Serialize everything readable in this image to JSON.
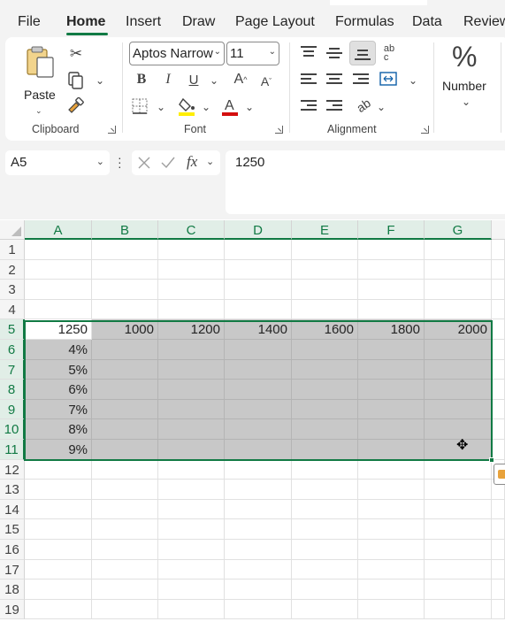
{
  "menu": {
    "tabs": [
      "File",
      "Home",
      "Insert",
      "Draw",
      "Page Layout",
      "Formulas",
      "Data",
      "Review"
    ],
    "active_tab": "Home"
  },
  "ribbon": {
    "clipboard": {
      "paste_label": "Paste",
      "group_label": "Clipboard"
    },
    "font": {
      "font_name": "Aptos Narrow",
      "font_size": "11",
      "group_label": "Font"
    },
    "alignment": {
      "group_label": "Alignment"
    },
    "number": {
      "symbol": "%",
      "label": "Number"
    }
  },
  "formula_bar": {
    "name_box": "A5",
    "fx_label": "fx",
    "formula": "1250"
  },
  "sheet": {
    "columns": [
      "A",
      "B",
      "C",
      "D",
      "E",
      "F",
      "G"
    ],
    "rows": [
      "1",
      "2",
      "3",
      "4",
      "5",
      "6",
      "7",
      "8",
      "9",
      "10",
      "11",
      "12",
      "13",
      "14",
      "15",
      "16",
      "17",
      "18",
      "19"
    ],
    "row5": [
      "1250",
      "1000",
      "1200",
      "1400",
      "1600",
      "1800",
      "2000"
    ],
    "colA": [
      "4%",
      "5%",
      "6%",
      "7%",
      "8%",
      "9%"
    ],
    "selection": "A5:G11"
  },
  "colors": {
    "accent": "#117a44",
    "selection_fill": "#c8c8c8",
    "header_bg": "#f5f5f5"
  }
}
